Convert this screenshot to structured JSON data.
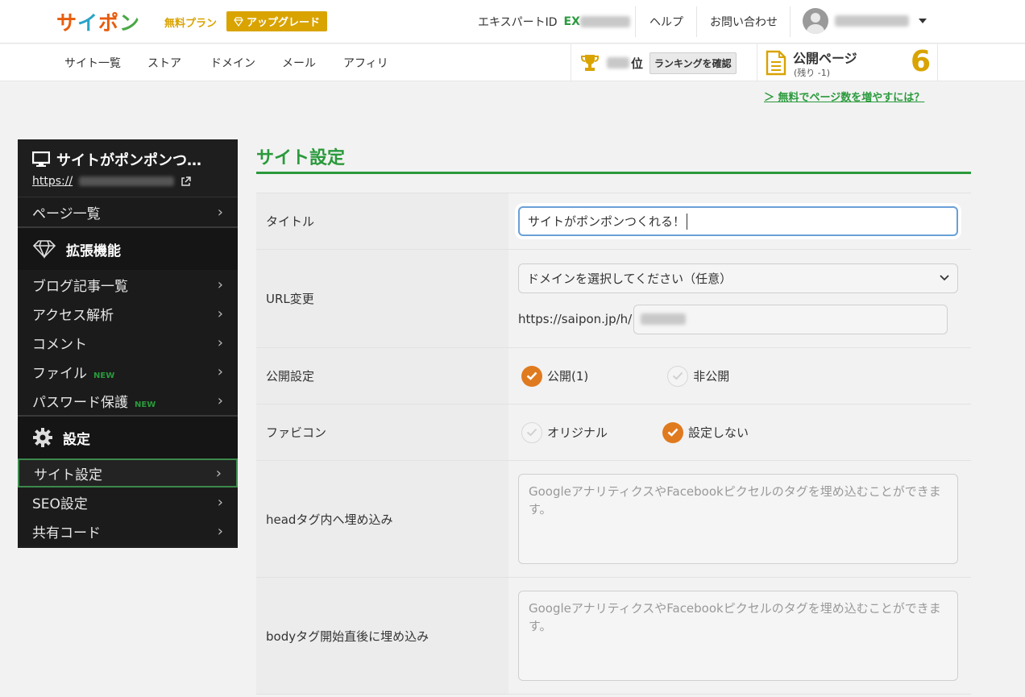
{
  "header": {
    "logo_text": "サイポン",
    "plan_label": "無料プラン",
    "upgrade_label": "アップグレード",
    "expert_label": "エキスパートID",
    "expert_prefix": "EX",
    "help_label": "ヘルプ",
    "contact_label": "お問い合わせ"
  },
  "subnav": {
    "items": [
      "サイト一覧",
      "ストア",
      "ドメイン",
      "メール",
      "アフィリ"
    ],
    "rank_suffix": "位",
    "rank_button": "ランキングを確認",
    "pages_title": "公開ページ",
    "pages_sub": "(残り -1)",
    "pages_count": "6",
    "more_pages_link": "＞ 無料でページ数を増やすには？"
  },
  "sidebar": {
    "site_title": "サイトがポンポンつ…",
    "site_url": "https://",
    "page_list": "ページ一覧",
    "ext_heading": "拡張機能",
    "ext_items": [
      {
        "label": "ブログ記事一覧",
        "new": ""
      },
      {
        "label": "アクセス解析",
        "new": ""
      },
      {
        "label": "コメント",
        "new": ""
      },
      {
        "label": "ファイル",
        "new": "NEW"
      },
      {
        "label": "パスワード保護",
        "new": "NEW"
      }
    ],
    "settings_heading": "設定",
    "settings_items": [
      "サイト設定",
      "SEO設定",
      "共有コード"
    ]
  },
  "main": {
    "title": "サイト設定",
    "rows": {
      "title_label": "タイトル",
      "title_value": "サイトがポンポンつくれる！",
      "url_label": "URL変更",
      "domain_select": "ドメインを選択してください（任意）",
      "url_prefix": "https://saipon.jp/h/",
      "publish_label": "公開設定",
      "publish_on": "公開(1)",
      "publish_off": "非公開",
      "favicon_label": "ファビコン",
      "favicon_original": "オリジナル",
      "favicon_none": "設定しない",
      "head_label": "headタグ内へ埋め込み",
      "head_placeholder": "GoogleアナリティクスやFacebookピクセルのタグを埋め込むことができます。",
      "body_label": "bodyタグ開始直後に埋め込み",
      "body_placeholder": "GoogleアナリティクスやFacebookピクセルのタグを埋め込むことができます。"
    }
  },
  "colors": {
    "brand_green": "#2a9a3c",
    "accent_gold": "#d9a300",
    "check_orange": "#e07a1f"
  }
}
